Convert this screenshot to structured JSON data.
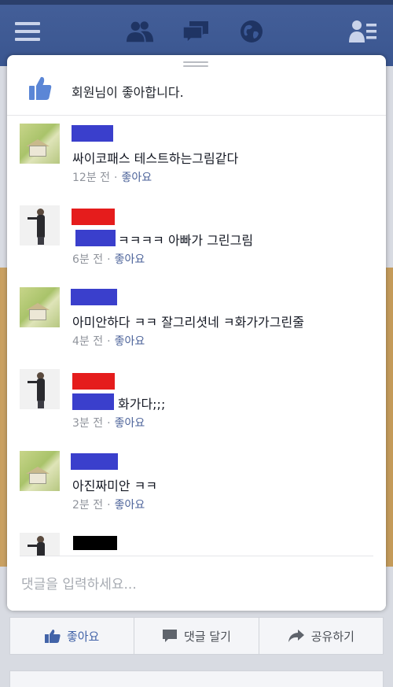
{
  "nav": {
    "icons": [
      "menu-icon",
      "friend-requests-icon",
      "messages-icon",
      "notifications-globe-icon",
      "contacts-icon"
    ]
  },
  "background": {
    "actions": {
      "like": "좋아요",
      "comment": "댓글 달기",
      "share": "공유하기"
    }
  },
  "modal": {
    "like_summary": "회원님이 좋아합니다.",
    "comments": [
      {
        "text": "싸이코패스 테스트하는그림같다",
        "time": "12분 전",
        "like": "좋아요"
      },
      {
        "text": "ㅋㅋㅋㅋ 아빠가 그린그림",
        "time": "6분 전",
        "like": "좋아요"
      },
      {
        "text": "아미안하다 ㅋㅋ 잘그리셧네 ㅋ화가가그린줄",
        "time": "4분 전",
        "like": "좋아요"
      },
      {
        "text": "화가다;;;",
        "time": "3분 전",
        "like": "좋아요"
      },
      {
        "text": "아진짜미안 ㅋㅋ",
        "time": "2분 전",
        "like": "좋아요"
      }
    ],
    "input_placeholder": "댓글을 입력하세요...",
    "dot": "·"
  },
  "colors": {
    "nav_bg": "#3b5998",
    "redact_blue": "#3a3fcc",
    "redact_red": "#e51c1c",
    "link": "#4b6299"
  }
}
